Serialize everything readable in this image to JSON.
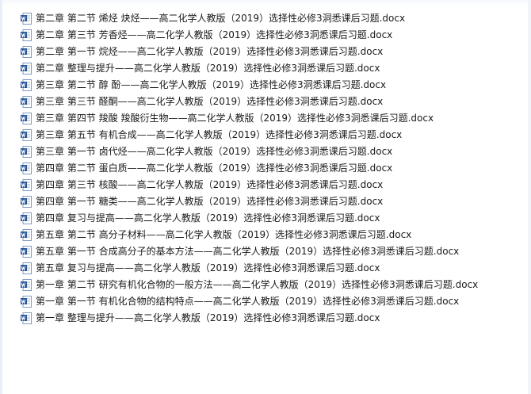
{
  "files": [
    {
      "name": "第二章 第二节 烯烃 炔烃——高二化学人教版（2019）选择性必修3洞悉课后习题.docx",
      "icon": "word-doc-icon"
    },
    {
      "name": "第二章 第三节 芳香烃——高二化学人教版（2019）选择性必修3洞悉课后习题.docx",
      "icon": "word-doc-icon"
    },
    {
      "name": "第二章 第一节 烷烃——高二化学人教版（2019）选择性必修3洞悉课后习题.docx",
      "icon": "word-doc-icon"
    },
    {
      "name": "第二章 整理与提升——高二化学人教版（2019）选择性必修3洞悉课后习题.docx",
      "icon": "word-doc-icon"
    },
    {
      "name": "第三章 第二节 醇 酚——高二化学人教版（2019）选择性必修3洞悉课后习题.docx",
      "icon": "word-doc-icon"
    },
    {
      "name": "第三章 第三节 醛酮——高二化学人教版（2019）选择性必修3洞悉课后习题.docx",
      "icon": "word-doc-icon"
    },
    {
      "name": "第三章 第四节 羧酸 羧酸衍生物——高二化学人教版（2019）选择性必修3洞悉课后习题.docx",
      "icon": "word-doc-icon"
    },
    {
      "name": "第三章 第五节 有机合成——高二化学人教版（2019）选择性必修3洞悉课后习题.docx",
      "icon": "word-doc-icon"
    },
    {
      "name": "第三章 第一节 卤代烃——高二化学人教版（2019）选择性必修3洞悉课后习题.docx",
      "icon": "word-doc-icon"
    },
    {
      "name": "第四章 第二节 蛋白质——高二化学人教版（2019）选择性必修3洞悉课后习题.docx",
      "icon": "word-doc-icon"
    },
    {
      "name": "第四章 第三节 核酸——高二化学人教版（2019）选择性必修3洞悉课后习题.docx",
      "icon": "word-doc-icon"
    },
    {
      "name": "第四章 第一节 糖类——高二化学人教版（2019）选择性必修3洞悉课后习题.docx",
      "icon": "word-doc-icon"
    },
    {
      "name": "第四章 复习与提高——高二化学人教版（2019）选择性必修3洞悉课后习题.docx",
      "icon": "word-doc-icon"
    },
    {
      "name": "第五章 第二节 高分子材料——高二化学人教版（2019）选择性必修3洞悉课后习题.docx",
      "icon": "word-doc-icon"
    },
    {
      "name": "第五章 第一节 合成高分子的基本方法——高二化学人教版（2019）选择性必修3洞悉课后习题.docx",
      "icon": "word-doc-icon"
    },
    {
      "name": "第五章 复习与提高——高二化学人教版（2019）选择性必修3洞悉课后习题.docx",
      "icon": "word-doc-icon"
    },
    {
      "name": "第一章 第二节 研究有机化合物的一般方法——高二化学人教版（2019）选择性必修3洞悉课后习题.docx",
      "icon": "word-doc-icon"
    },
    {
      "name": "第一章 第一节 有机化合物的结构特点——高二化学人教版（2019）选择性必修3洞悉课后习题.docx",
      "icon": "word-doc-icon"
    },
    {
      "name": "第一章 整理与提升——高二化学人教版（2019）选择性必修3洞悉课后习题.docx",
      "icon": "word-doc-icon"
    }
  ],
  "colors": {
    "icon_blue": "#2b5797",
    "icon_page": "#ffffff",
    "text": "#1a1a1a"
  }
}
